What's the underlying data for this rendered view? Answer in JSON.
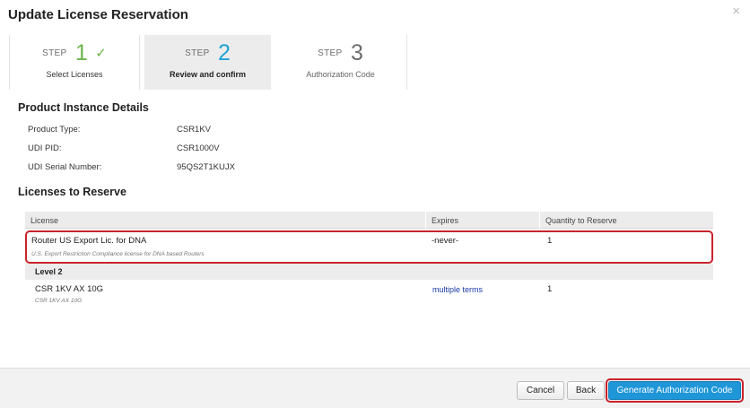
{
  "dialog": {
    "title": "Update License Reservation",
    "close_glyph": "×"
  },
  "steps": [
    {
      "word": "STEP",
      "number": "1",
      "label": "Select Licenses",
      "state": "complete",
      "check_glyph": "✓"
    },
    {
      "word": "STEP",
      "number": "2",
      "label": "Review and confirm",
      "state": "active"
    },
    {
      "word": "STEP",
      "number": "3",
      "label": "Authorization Code",
      "state": "pending"
    }
  ],
  "product_details": {
    "heading": "Product Instance Details",
    "rows": [
      {
        "label": "Product Type:",
        "value": "CSR1KV"
      },
      {
        "label": "UDI PID:",
        "value": "CSR1000V"
      },
      {
        "label": "UDI Serial Number:",
        "value": "95QS2T1KUJX"
      }
    ]
  },
  "licenses": {
    "heading": "Licenses to Reserve",
    "columns": [
      "License",
      "Expires",
      "Quantity to Reserve"
    ],
    "rows": [
      {
        "name": "Router US Export Lic. for DNA",
        "description": "U.S. Export Restriction Compliance license for DNA based Routers",
        "expires": "-never-",
        "quantity": "1",
        "highlighted": true
      }
    ],
    "groups": [
      {
        "label": "Level 2",
        "rows": [
          {
            "name": "CSR 1KV AX 10G",
            "description": "CSR 1KV AX 10G",
            "expires": "multiple terms",
            "quantity": "1"
          }
        ]
      }
    ]
  },
  "footer": {
    "cancel_label": "Cancel",
    "back_label": "Back",
    "generate_label": "Generate Authorization Code"
  },
  "colors": {
    "step_complete": "#6cb34a",
    "step_active": "#22a2d6",
    "highlight_outline": "#c8242c",
    "primary_button": "#1e96d8",
    "link": "#1a39a6"
  },
  "icons": {
    "close": "close-icon",
    "step_complete": "checkmark-icon"
  }
}
